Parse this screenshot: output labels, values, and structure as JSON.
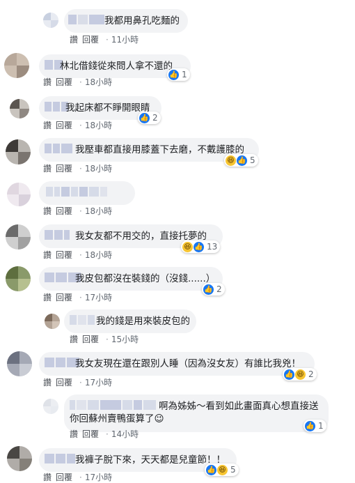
{
  "actions": {
    "like": "讚",
    "reply": "回覆"
  },
  "reaction_icons": {
    "like": "like-icon",
    "haha": "haha-icon"
  },
  "colors": {
    "bubble": "#f2f3f5",
    "like": "#1877f2",
    "haha": "#f7c531"
  },
  "comments": [
    {
      "text": "我都用鼻孔吃麵的",
      "time": "11小時",
      "reactions": ""
    },
    {
      "text": "林北借錢從來問人拿不還的",
      "time": "18小時",
      "reactions": "1"
    },
    {
      "text": "我起床都不睜開眼睛",
      "time": "18小時",
      "reactions": "2"
    },
    {
      "text": "我壓車都直接用膝蓋下去磨，不戴護膝的",
      "time": "18小時",
      "reactions": "5"
    },
    {
      "text": "",
      "time": "18小時",
      "reactions": ""
    },
    {
      "text": "我女友都不用交的，直接托夢的",
      "time": "18小時",
      "reactions": "13"
    },
    {
      "text": "我皮包都沒在裝錢的（沒錢......）",
      "time": "17小時",
      "reactions": "2"
    },
    {
      "text": "我的錢是用來裝皮包的",
      "time": "15小時",
      "reactions": ""
    },
    {
      "text": "我女友現在還在跟別人睡（因為沒女友）有誰比我兇！",
      "time": "17小時",
      "reactions": "2"
    },
    {
      "text": "啊為姊姊～看到如此畫面真心想直接送你回蘇州賣鴨蛋算了😉",
      "time": "14小時",
      "reactions": "1"
    },
    {
      "text": "我褲子脫下來，天天都是兒童節！！",
      "time": "17小時",
      "reactions": "5"
    }
  ]
}
